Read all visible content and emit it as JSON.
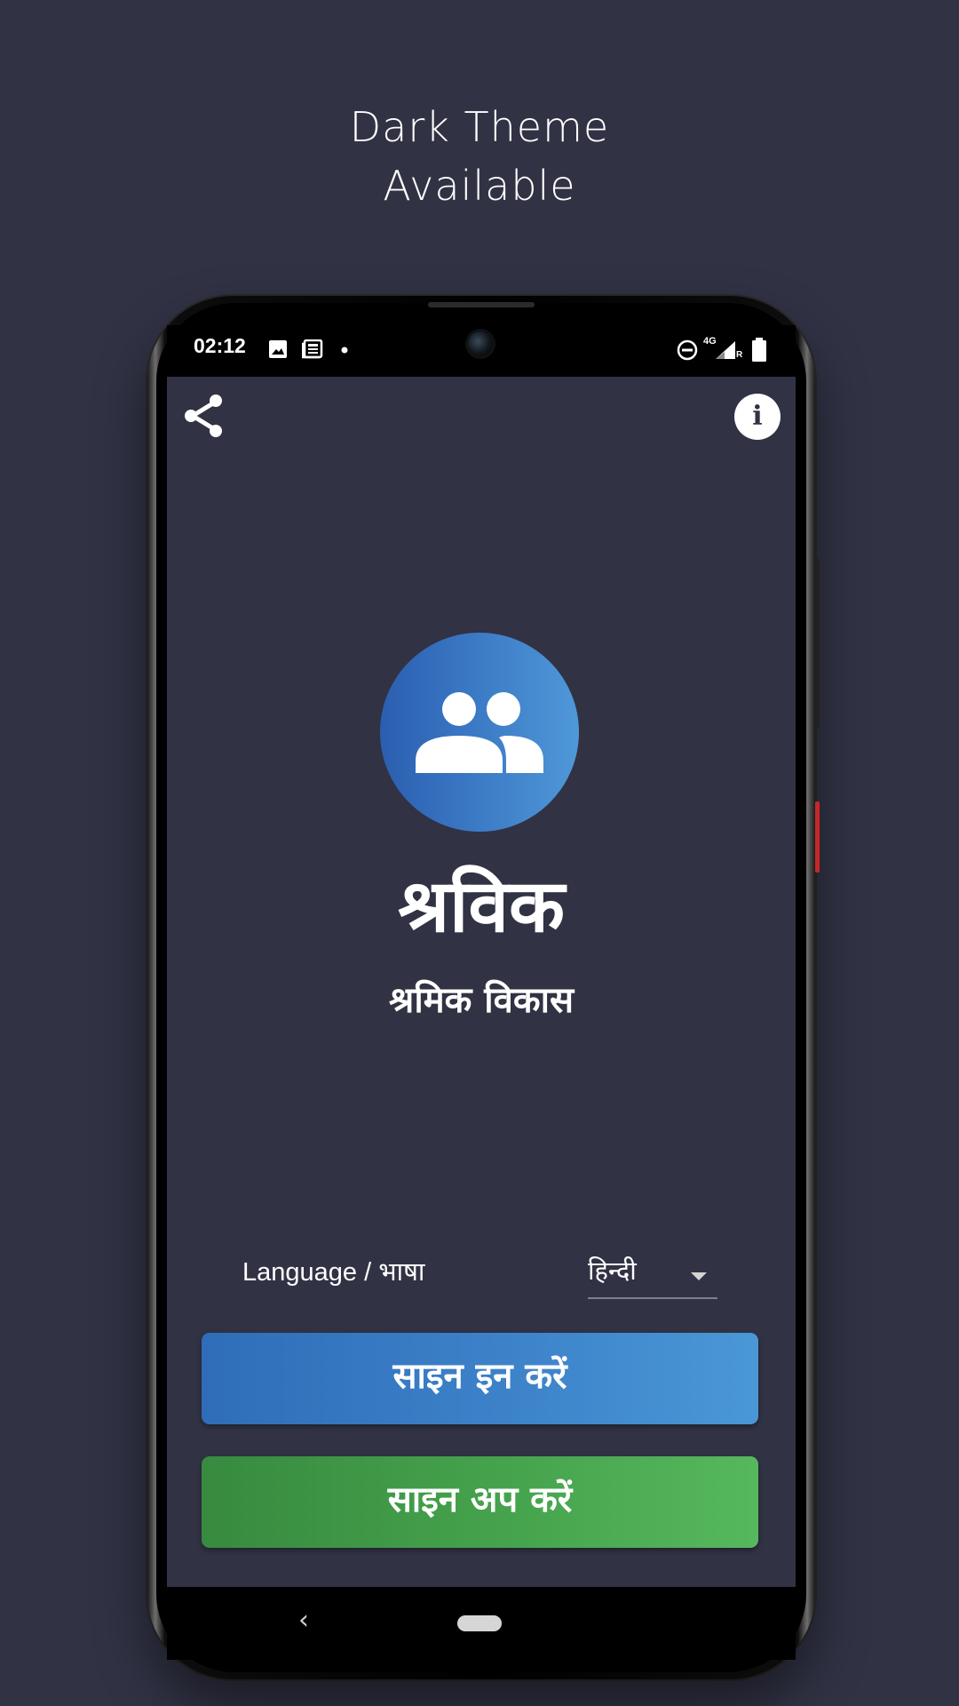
{
  "promo": {
    "line1": "Dark Theme",
    "line2": "Available"
  },
  "status_bar": {
    "time": "02:12",
    "left_icons": [
      "image-icon",
      "news-icon",
      "dot-icon"
    ],
    "right_icons": [
      "dnd-icon",
      "4g-icon",
      "signal-icon",
      "battery-icon"
    ],
    "network_label": "4G",
    "roaming_label": "R"
  },
  "toolbar": {
    "share_icon": "share-icon",
    "info_icon": "info-icon",
    "info_glyph": "i"
  },
  "app": {
    "logo_icon": "group-people-icon",
    "title": "श्रविक",
    "subtitle": "श्रमिक विकास"
  },
  "language": {
    "label": "Language / भाषा",
    "selected": "हिन्दी"
  },
  "buttons": {
    "signin_label": "साइन इन करें",
    "signup_label": "साइन अप करें"
  },
  "colors": {
    "background": "#313244",
    "signin": "#3b80c8",
    "signup": "#46a34d",
    "logo": "#3a78c4"
  },
  "nav": {
    "back_glyph": "‹"
  }
}
